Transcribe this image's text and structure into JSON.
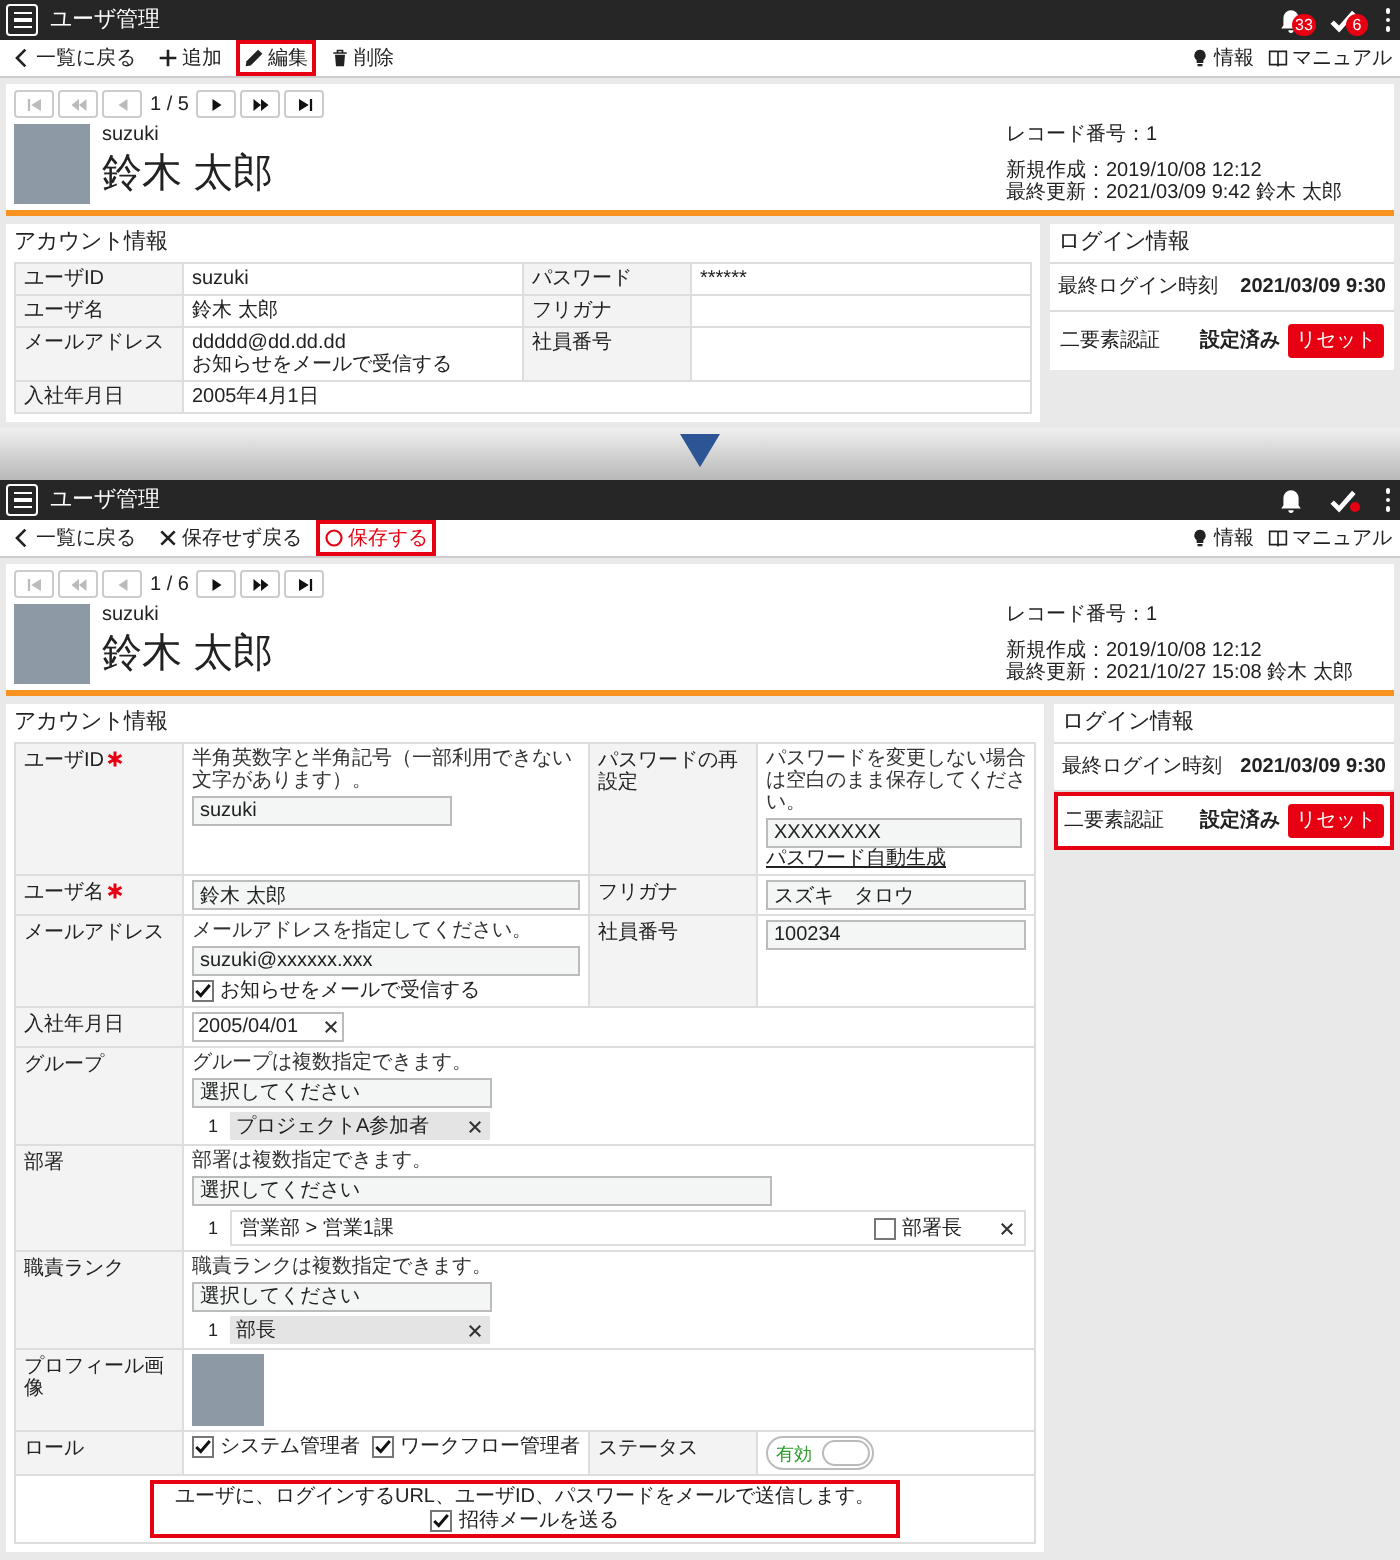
{
  "screens": [
    {
      "kind": "view",
      "header": {
        "title": "ユーザ管理",
        "bell_badge": "33",
        "check_badge": "6"
      },
      "toolbar": [
        {
          "kind": "back",
          "label": "一覧に戻る",
          "highlighted": false,
          "accent": false
        },
        {
          "kind": "add",
          "label": "追加",
          "highlighted": false,
          "accent": false
        },
        {
          "kind": "edit",
          "label": "編集",
          "highlighted": true,
          "accent": false
        },
        {
          "kind": "delete",
          "label": "削除",
          "highlighted": false,
          "accent": false
        }
      ],
      "toolbar_right": [
        {
          "kind": "info",
          "label": "情報"
        },
        {
          "kind": "manual",
          "label": "マニュアル"
        }
      ],
      "pager": {
        "position": "1 / 5",
        "at_first": true
      },
      "profile": {
        "user_id": "suzuki",
        "name": "鈴木 太郎",
        "record_number": "レコード番号：1",
        "created": "新規作成：2019/10/08 12:12",
        "updated": "最終更新：2021/03/09 9:42 鈴木 太郎"
      },
      "account": {
        "title": "アカウント情報",
        "rows": [
          [
            {
              "label": "ユーザID",
              "values": [
                "suzuki"
              ]
            },
            {
              "label": "パスワード",
              "values": [
                "******"
              ]
            }
          ],
          [
            {
              "label": "ユーザ名",
              "values": [
                "鈴木 太郎"
              ]
            },
            {
              "label": "フリガナ"
            }
          ],
          [
            {
              "label": "メールアドレス",
              "values": [
                "ddddd@dd.dd.dd",
                "お知らせをメールで受信する"
              ]
            },
            {
              "label": "社員番号"
            }
          ],
          [
            {
              "label": "入社年月日",
              "values": [
                "2005年4月1日"
              ]
            }
          ]
        ]
      },
      "login": {
        "title": "ログイン情報",
        "last_login": {
          "label": "最終ログイン時刻",
          "value": "2021/03/09 9:30"
        },
        "two_factor": {
          "label": "二要素認証",
          "status": "設定済み",
          "button": "リセット",
          "highlighted": false
        }
      }
    },
    {
      "kind": "edit",
      "header": {
        "title": "ユーザ管理",
        "check_dot": true
      },
      "toolbar": [
        {
          "kind": "back",
          "label": "一覧に戻る",
          "highlighted": false,
          "accent": false
        },
        {
          "kind": "discard",
          "label": "保存せず戻る",
          "highlighted": false,
          "accent": false
        },
        {
          "kind": "save",
          "label": "保存する",
          "highlighted": true,
          "accent": true
        }
      ],
      "toolbar_right": [
        {
          "kind": "info",
          "label": "情報"
        },
        {
          "kind": "manual",
          "label": "マニュアル"
        }
      ],
      "pager": {
        "position": "1 / 6",
        "at_first": true
      },
      "profile": {
        "user_id": "suzuki",
        "name": "鈴木 太郎",
        "record_number": "レコード番号：1",
        "created": "新規作成：2019/10/08 12:12",
        "updated": "最終更新：2021/10/27 15:08 鈴木 太郎"
      },
      "account": {
        "title": "アカウント情報",
        "rows": [
          [
            {
              "label": "ユーザID",
              "required": true,
              "parts": [
                {
                  "kind": "hint",
                  "text": "半角英数字と半角記号（一部利用できない文字があります）。"
                },
                {
                  "kind": "input",
                  "value": "suzuki"
                }
              ]
            },
            {
              "label": "パスワードの再設定",
              "required": false,
              "parts": [
                {
                  "kind": "hint",
                  "text": "パスワードを変更しない場合は空白のまま保存してください。"
                },
                {
                  "kind": "input_with_link",
                  "value": "XXXXXXXX",
                  "link": "パスワード自動生成"
                }
              ]
            }
          ],
          [
            {
              "label": "ユーザ名",
              "required": true,
              "parts": [
                {
                  "kind": "wide_input",
                  "value": "鈴木 太郎"
                }
              ]
            },
            {
              "label": "フリガナ",
              "required": false,
              "parts": [
                {
                  "kind": "wide_input",
                  "value": "スズキ　タロウ"
                }
              ]
            }
          ],
          [
            {
              "label": "メールアドレス",
              "required": false,
              "parts": [
                {
                  "kind": "hint",
                  "text": "メールアドレスを指定してください。"
                },
                {
                  "kind": "wide_input",
                  "value": "suzuki@xxxxxx.xxx"
                },
                {
                  "kind": "checkbox",
                  "label": "お知らせをメールで受信する",
                  "checked": true
                }
              ]
            },
            {
              "label": "社員番号",
              "required": false,
              "parts": [
                {
                  "kind": "input",
                  "value": "100234"
                }
              ]
            }
          ],
          [
            {
              "label": "入社年月日",
              "required": false,
              "parts": [
                {
                  "kind": "date",
                  "value": "2005/04/01"
                }
              ]
            }
          ],
          [
            {
              "label": "グループ",
              "required": false,
              "parts": [
                {
                  "kind": "hint",
                  "text": "グループは複数指定できます。"
                },
                {
                  "kind": "select",
                  "placeholder": "選択してください"
                },
                {
                  "kind": "chip",
                  "index": "1",
                  "label": "プロジェクトA参加者"
                }
              ]
            }
          ],
          [
            {
              "label": "部署",
              "required": false,
              "parts": [
                {
                  "kind": "hint",
                  "text": "部署は複数指定できます。"
                },
                {
                  "kind": "wide_select",
                  "placeholder": "選択してください"
                },
                {
                  "kind": "department",
                  "index": "1",
                  "label": "営業部 > 営業1課",
                  "option": "部署長",
                  "checked": false
                }
              ]
            }
          ],
          [
            {
              "label": "職責ランク",
              "required": false,
              "parts": [
                {
                  "kind": "hint",
                  "text": "職責ランクは複数指定できます。"
                },
                {
                  "kind": "select",
                  "placeholder": "選択してください"
                },
                {
                  "kind": "chip",
                  "index": "1",
                  "label": "部長"
                }
              ]
            }
          ],
          [
            {
              "label": "プロフィール画像",
              "required": false,
              "parts": [
                {
                  "kind": "photo"
                }
              ]
            }
          ],
          [
            {
              "label": "ロール",
              "required": false,
              "parts": [
                {
                  "kind": "checkbox_group",
                  "options": [
                    {
                      "label": "システム管理者",
                      "checked": true
                    },
                    {
                      "label": "ワークフロー管理者",
                      "checked": true
                    }
                  ]
                }
              ]
            },
            {
              "label": "ステータス",
              "required": false,
              "parts": [
                {
                  "kind": "toggle",
                  "label": "有効",
                  "on": true
                }
              ]
            }
          ]
        ],
        "invite": {
          "text": "ユーザに、ログインするURL、ユーザID、パスワードをメールで送信します。",
          "checkbox": {
            "label": "招待メールを送る",
            "checked": true
          },
          "highlighted": true
        }
      },
      "login": {
        "title": "ログイン情報",
        "last_login": {
          "label": "最終ログイン時刻",
          "value": "2021/03/09 9:30"
        },
        "two_factor": {
          "label": "二要素認証",
          "status": "設定済み",
          "button": "リセット",
          "highlighted": true
        }
      }
    }
  ]
}
